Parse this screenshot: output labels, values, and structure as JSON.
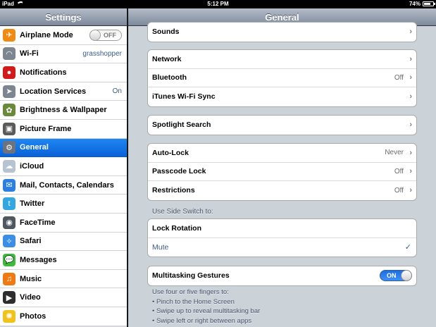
{
  "status_bar": {
    "device": "iPad",
    "time": "5:12 PM",
    "battery": "74%",
    "battery_level": 0.74
  },
  "sidebar": {
    "title": "Settings",
    "items": [
      {
        "label": "Airplane Mode",
        "icon": "airplane-icon",
        "color": "#f08a12",
        "toggle": "OFF"
      },
      {
        "label": "Wi-Fi",
        "icon": "wifi-icon",
        "color": "#7d8590",
        "value": "grasshopper"
      },
      {
        "label": "Notifications",
        "icon": "notifications-icon",
        "color": "#d11b1b"
      },
      {
        "label": "Location Services",
        "icon": "location-icon",
        "color": "#7d8590",
        "value": "On"
      },
      {
        "label": "Brightness & Wallpaper",
        "icon": "brightness-icon",
        "color": "#6a8a3a"
      },
      {
        "label": "Picture Frame",
        "icon": "picture-frame-icon",
        "color": "#5a5a5a"
      },
      {
        "label": "General",
        "icon": "gear-icon",
        "color": "#6c737c",
        "selected": true
      },
      {
        "label": "iCloud",
        "icon": "icloud-icon",
        "color": "#b7c3d1"
      },
      {
        "label": "Mail, Contacts, Calendars",
        "icon": "mail-icon",
        "color": "#2a7fe0"
      },
      {
        "label": "Twitter",
        "icon": "twitter-icon",
        "color": "#34a7e0"
      },
      {
        "label": "FaceTime",
        "icon": "facetime-icon",
        "color": "#4e5660"
      },
      {
        "label": "Safari",
        "icon": "safari-icon",
        "color": "#3b8ee8"
      },
      {
        "label": "Messages",
        "icon": "messages-icon",
        "color": "#3dbb3d"
      },
      {
        "label": "Music",
        "icon": "music-icon",
        "color": "#f07a12"
      },
      {
        "label": "Video",
        "icon": "video-icon",
        "color": "#2d2d2d"
      },
      {
        "label": "Photos",
        "icon": "photos-icon",
        "color": "#f0c21a"
      }
    ]
  },
  "main": {
    "title": "General",
    "groups": {
      "sounds": [
        {
          "label": "Sounds"
        }
      ],
      "network": [
        {
          "label": "Network"
        },
        {
          "label": "Bluetooth",
          "value": "Off"
        },
        {
          "label": "iTunes Wi-Fi Sync"
        }
      ],
      "spotlight": [
        {
          "label": "Spotlight Search"
        }
      ],
      "lock": [
        {
          "label": "Auto-Lock",
          "value": "Never"
        },
        {
          "label": "Passcode Lock",
          "value": "Off"
        },
        {
          "label": "Restrictions",
          "value": "Off"
        }
      ],
      "side_switch_header": "Use Side Switch to:",
      "side_switch": [
        {
          "label": "Lock Rotation"
        },
        {
          "label": "Mute",
          "checked": true
        }
      ],
      "multitasking": {
        "label": "Multitasking Gestures",
        "toggle": "ON"
      },
      "footnote": [
        "Use four or five fingers to:",
        "• Pinch to the Home Screen",
        "• Swipe up to reveal multitasking bar",
        "• Swipe left or right between apps"
      ]
    },
    "chevron": "›",
    "checkmark": "✓"
  }
}
